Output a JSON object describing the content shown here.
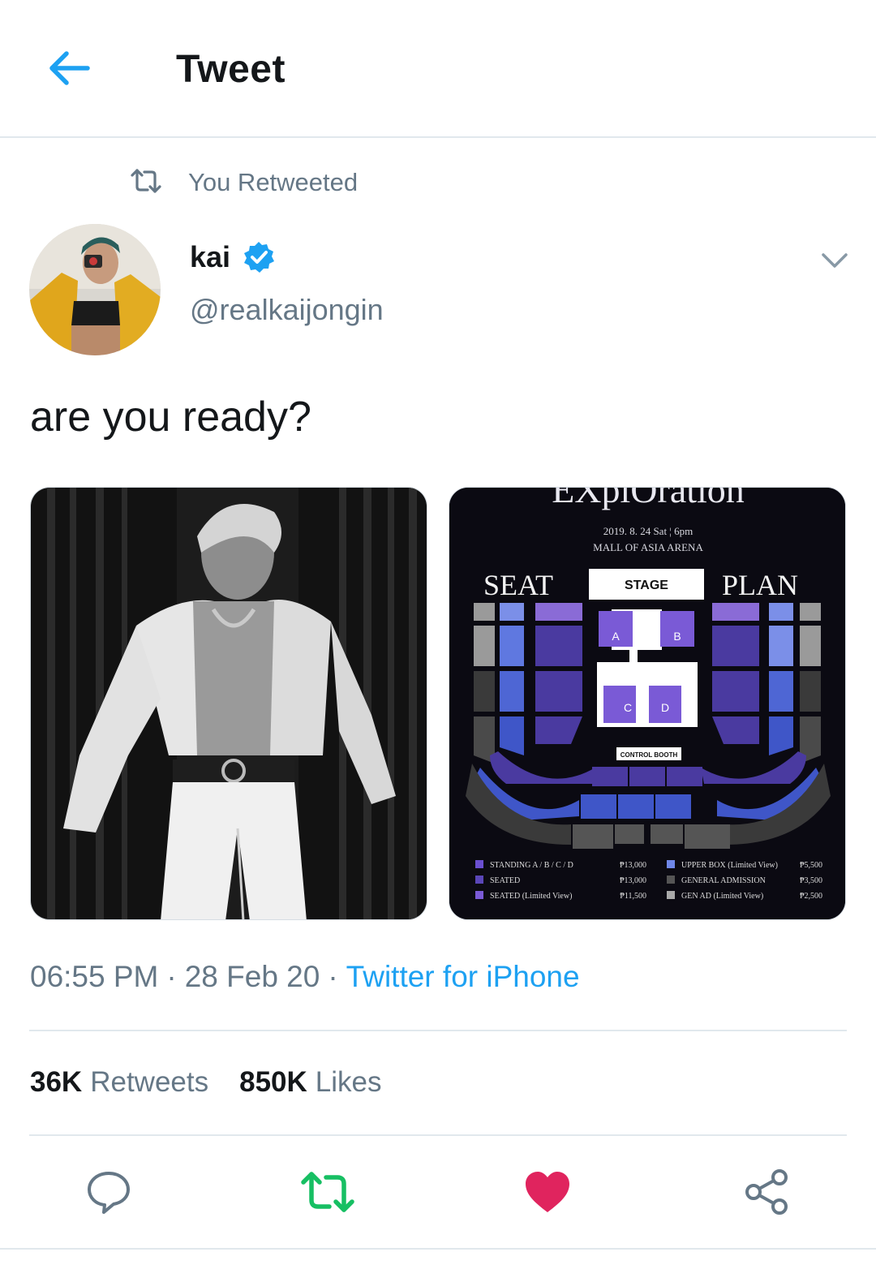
{
  "header": {
    "title": "Tweet"
  },
  "retweet_context": {
    "text": "You Retweeted"
  },
  "author": {
    "name": "kai",
    "handle": "@realkaijongin",
    "verified": true
  },
  "tweet": {
    "text": "are you ready?"
  },
  "poster": {
    "title_fragment": "EXplOration",
    "date_line": "2019. 8. 24 Sat ¦ 6pm",
    "venue": "MALL OF ASIA ARENA",
    "seat": "SEAT",
    "plan": "PLAN",
    "stage": "STAGE",
    "control_booth": "CONTROL BOOTH",
    "floor_labels": {
      "a": "A",
      "b": "B",
      "c": "C",
      "d": "D"
    },
    "legend": [
      {
        "label": "STANDING A / B / C / D",
        "price": "₱13,000",
        "color": "#6a4fd0"
      },
      {
        "label": "SEATED",
        "price": "₱13,000",
        "color": "#5a46b8"
      },
      {
        "label": "SEATED (Limited View)",
        "price": "₱11,500",
        "color": "#7a5ad6"
      },
      {
        "label": "UPPER BOX (Limited View)",
        "price": "₱5,500",
        "color": "#6f87e8"
      },
      {
        "label": "GENERAL ADMISSION",
        "price": "₱3,500",
        "color": "#555555"
      },
      {
        "label": "GEN AD (Limited View)",
        "price": "₱2,500",
        "color": "#a9a9a9"
      }
    ]
  },
  "meta": {
    "time": "06:55 PM",
    "date": "28 Feb 20",
    "source": "Twitter for iPhone",
    "sep": "·"
  },
  "stats": {
    "retweets_count": "36K",
    "retweets_label": "Retweets",
    "likes_count": "850K",
    "likes_label": "Likes"
  },
  "colors": {
    "accent": "#1da1f2",
    "retweet_green": "#17bf63",
    "like_red": "#e0245e",
    "muted": "#657786"
  }
}
